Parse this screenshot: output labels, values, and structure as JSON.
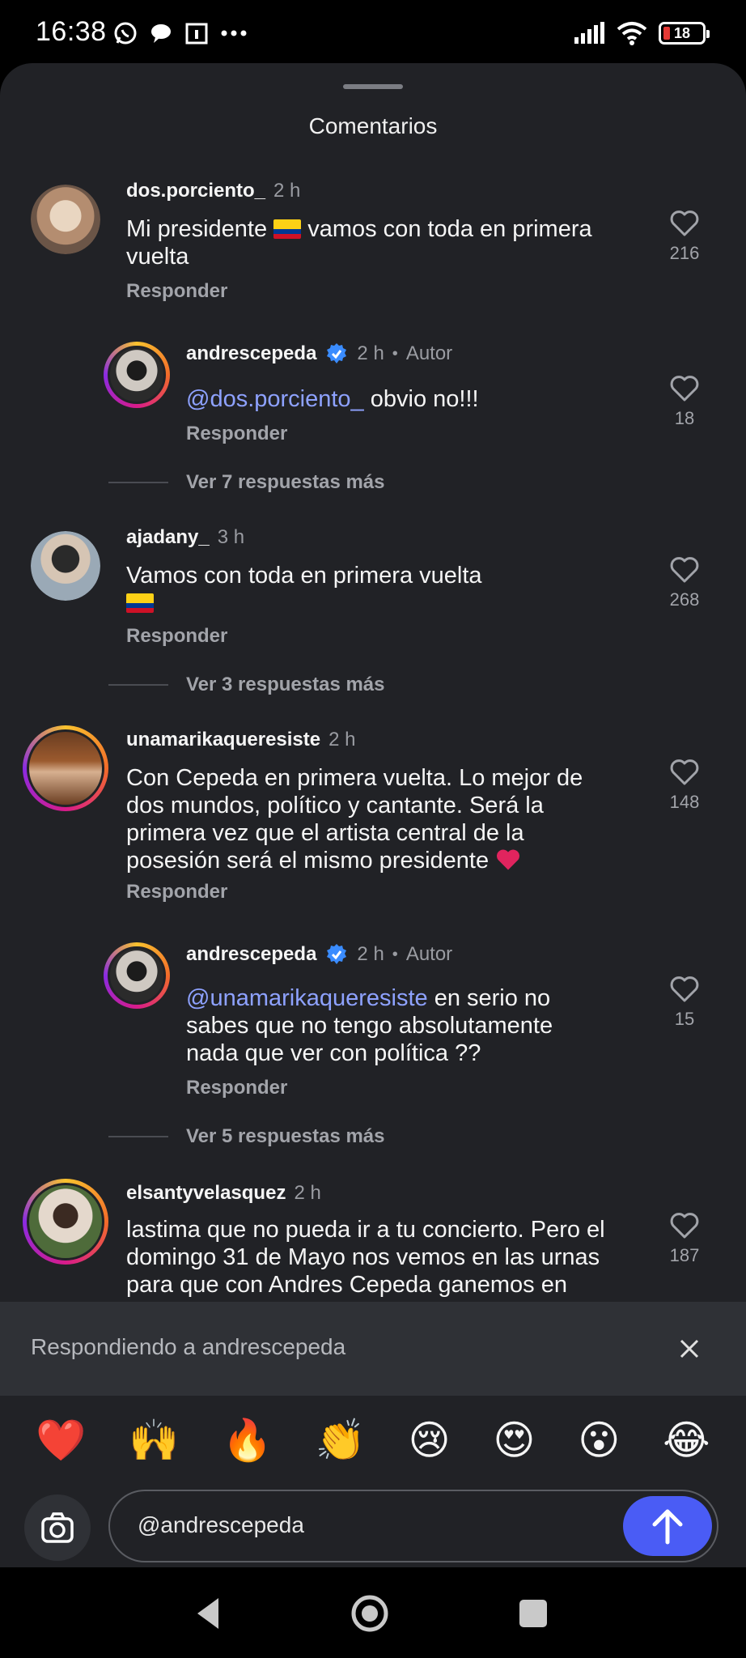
{
  "status_bar": {
    "time": "16:38",
    "left_icons": [
      "whatsapp-icon",
      "chat-bubble-icon",
      "calendar-icon",
      "more-dots-icon"
    ],
    "right_icons": [
      "signal-icon",
      "wifi-icon",
      "battery-icon"
    ],
    "battery_level": "18",
    "battery_color": "#e53935"
  },
  "sheet": {
    "title": "Comentarios"
  },
  "comments": [
    {
      "username": "dos.porciento_",
      "time": "2 h",
      "text_line1": "Mi presidente",
      "text_after_flag": " vamos con toda en primera",
      "text_line2": "vuelta",
      "reply_label": "Responder",
      "likes": "216"
    },
    {
      "username": "andrescepeda",
      "verified": true,
      "time": "2 h",
      "author_label": "Autor",
      "mention": "@dos.porciento_",
      "text": " obvio no!!!",
      "reply_label": "Responder",
      "likes": "18"
    },
    {
      "more_replies": "Ver 7 respuestas más"
    },
    {
      "username": "ajadany_",
      "time": "3 h",
      "text_line1": "Vamos con toda en primera vuelta",
      "reply_label": "Responder",
      "likes": "268"
    },
    {
      "more_replies": "Ver 3 respuestas más"
    },
    {
      "username": "unamarikaqueresiste",
      "time": "2 h",
      "lines": [
        "Con Cepeda en primera vuelta. Lo mejor de",
        "dos mundos, político y cantante. Será la",
        "primera vez que el artista central de la",
        "posesión será el mismo presidente"
      ],
      "reply_label": "Responder",
      "likes": "148"
    },
    {
      "username": "andrescepeda",
      "verified": true,
      "time": "2 h",
      "author_label": "Autor",
      "mention": "@unamarikaqueresiste",
      "line1_after_mention": " en serio no",
      "line2": "sabes que no tengo absolutamente",
      "line3": "nada que ver con política ??",
      "reply_label": "Responder",
      "likes": "15"
    },
    {
      "more_replies": "Ver 5 respuestas más"
    },
    {
      "username": "elsantyvelasquez",
      "time": "2 h",
      "lines": [
        "lastima que no pueda ir a tu concierto. Pero el",
        "domingo 31 de Mayo nos vemos en las urnas",
        "para que con Andres Cepeda ganemos en"
      ],
      "likes": "187"
    }
  ],
  "replying_bar": {
    "text": "Respondiendo a andrescepeda"
  },
  "emoji_bar": [
    "❤️",
    "🙌",
    "🔥",
    "👏",
    "😢",
    "😍",
    "😮",
    "😂"
  ],
  "input_bar": {
    "value": "@andrescepeda",
    "accent": "#4a5cf5"
  },
  "nav_bar": {
    "buttons": [
      "back-icon",
      "home-icon",
      "recents-icon"
    ]
  }
}
